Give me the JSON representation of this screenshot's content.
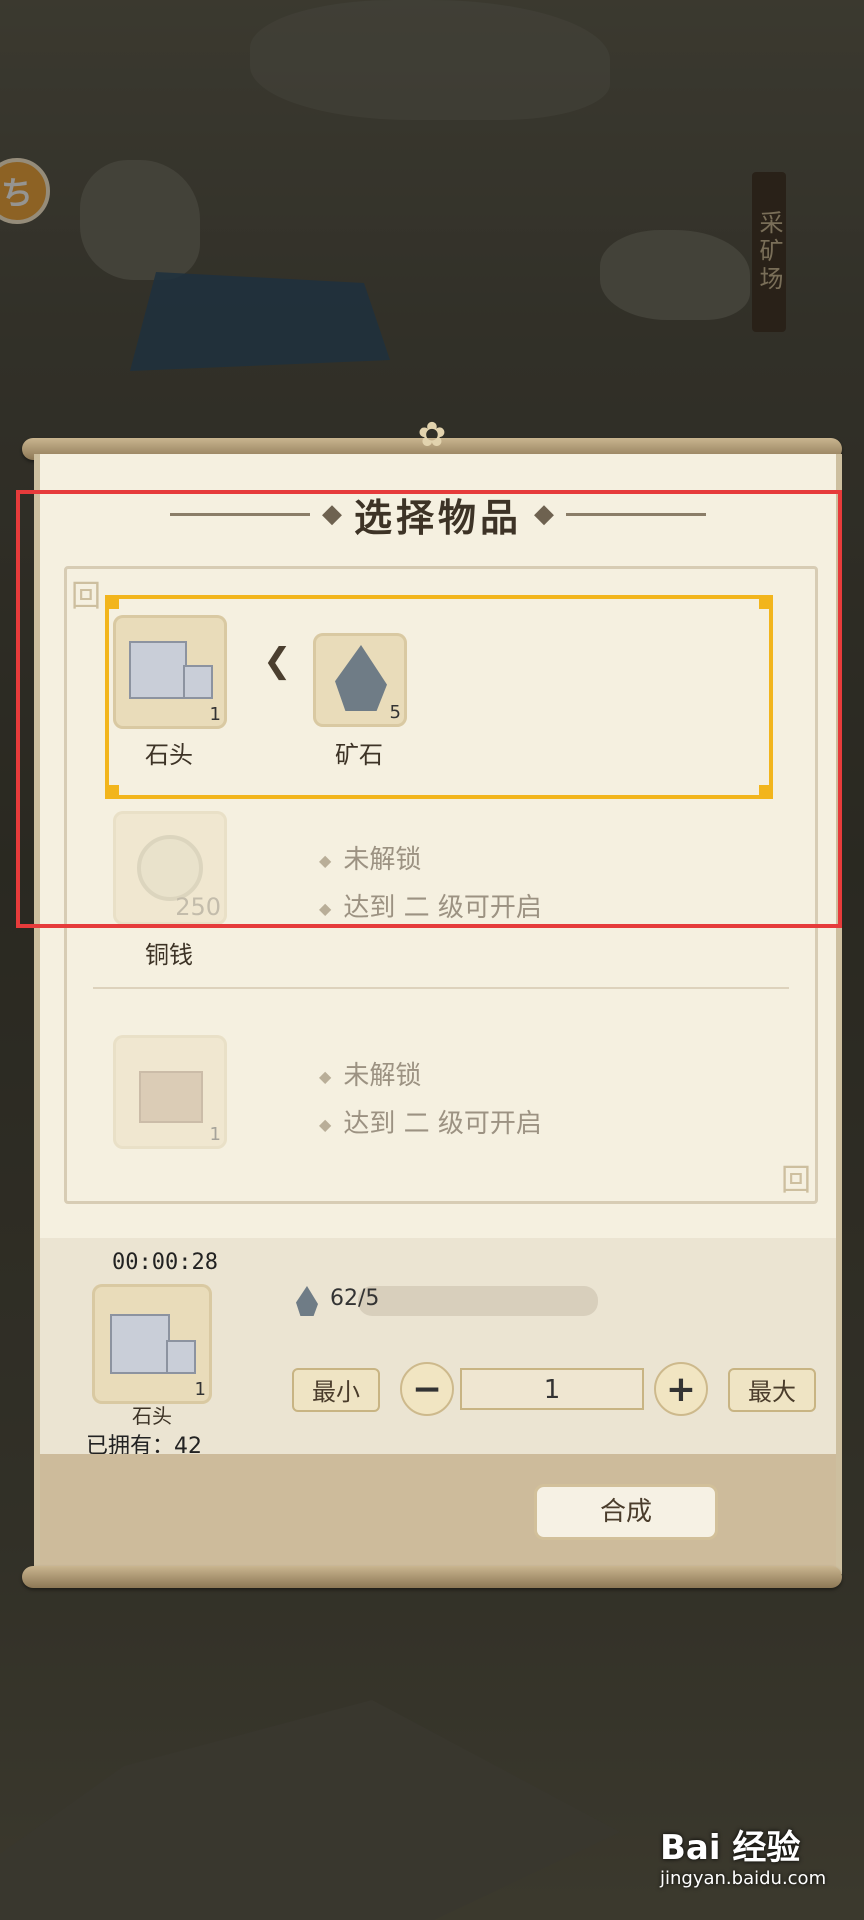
{
  "background": {
    "location_sign": "采矿场"
  },
  "dialog": {
    "title": "选择物品",
    "recipes": [
      {
        "output": {
          "name": "石头",
          "icon": "stone-cube-icon",
          "quantity": "1"
        },
        "input": {
          "name": "矿石",
          "icon": "ore-icon",
          "quantity": "5"
        },
        "selected": true
      },
      {
        "output": {
          "name": "铜钱",
          "icon": "copper-coin-icon",
          "quantity": "250"
        },
        "locked_label": "未解锁",
        "unlock_hint": "达到 二 级可开启"
      },
      {
        "output": {
          "name": "",
          "icon": "brick-icon",
          "quantity": "1"
        },
        "locked_label": "未解锁",
        "unlock_hint": "达到 二 级可开启"
      }
    ],
    "craft_panel": {
      "timer": "00:00:28",
      "item_name": "石头",
      "item_quantity": "1",
      "owned_text": "已拥有：42",
      "requirement": "62/5",
      "min_label": "最小",
      "max_label": "最大",
      "minus_label": "−",
      "plus_label": "+",
      "amount": "1",
      "craft_label": "合成"
    }
  },
  "colors": {
    "selection_border": "#f2b51c",
    "annotation_border": "#e63b3b"
  },
  "watermark": {
    "text": "Bai 经验",
    "url_text": "jingyan.baidu.com"
  }
}
